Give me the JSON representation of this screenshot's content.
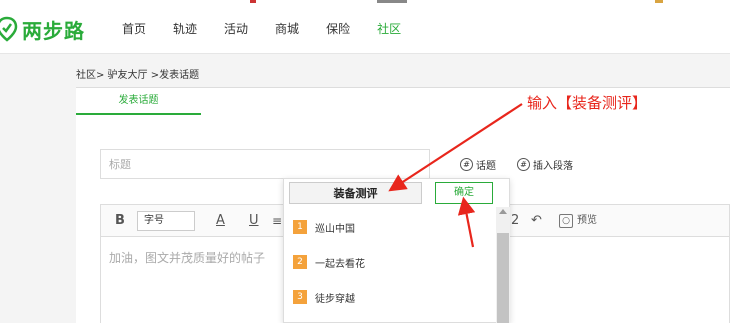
{
  "brand": {
    "name": "两步路",
    "accent": "#2aab3a"
  },
  "nav": {
    "items": [
      {
        "label": "首页"
      },
      {
        "label": "轨迹"
      },
      {
        "label": "活动"
      },
      {
        "label": "商城"
      },
      {
        "label": "保险"
      },
      {
        "label": "社区",
        "active": true
      }
    ]
  },
  "breadcrumb": "社区> 驴友大厅 >发表话题",
  "tab": {
    "label": "发表话题"
  },
  "title_field": {
    "placeholder": "标题"
  },
  "options": {
    "topic": "话题",
    "insert_paragraph": "插入段落"
  },
  "toolbar": {
    "bold": "B",
    "font_size": "字号",
    "underline_a": "A",
    "underline_u": "U",
    "preview": "预览"
  },
  "editor": {
    "placeholder": "加油，图文并茂质量好的帖子"
  },
  "topic_popup": {
    "value": "装备测评",
    "confirm": "确定",
    "items": [
      {
        "num": "1",
        "label": "巡山中国"
      },
      {
        "num": "2",
        "label": "一起去看花"
      },
      {
        "num": "3",
        "label": "徒步穿越"
      }
    ]
  },
  "annotation": {
    "text": "输入【装备测评】",
    "color": "#e8261c"
  }
}
